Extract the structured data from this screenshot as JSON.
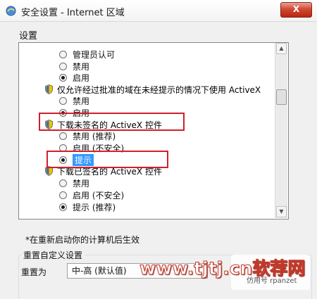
{
  "window": {
    "title": "安全设置 - Internet 区域",
    "close_label": "X"
  },
  "settings": {
    "group_label": "设置",
    "items": [
      {
        "type": "option",
        "label": "管理员认可",
        "checked": false
      },
      {
        "type": "option",
        "label": "禁用",
        "checked": false
      },
      {
        "type": "option",
        "label": "启用",
        "checked": true
      },
      {
        "type": "header",
        "label": "仅允许经过批准的域在未经提示的情况下使用 ActiveX"
      },
      {
        "type": "option",
        "label": "禁用",
        "checked": false
      },
      {
        "type": "option",
        "label": "启用",
        "checked": true
      },
      {
        "type": "header",
        "label": "下载未签名的 ActiveX 控件"
      },
      {
        "type": "option",
        "label": "禁用 (推荐)",
        "checked": false
      },
      {
        "type": "option",
        "label": "启用 (不安全)",
        "checked": false
      },
      {
        "type": "option",
        "label": "提示",
        "checked": true,
        "selected": true
      },
      {
        "type": "header",
        "label": "下载已签名的 ActiveX 控件"
      },
      {
        "type": "option",
        "label": "禁用",
        "checked": false
      },
      {
        "type": "option",
        "label": "启用 (不安全)",
        "checked": false
      },
      {
        "type": "option",
        "label": "提示 (推荐)",
        "checked": true
      }
    ]
  },
  "note": "*在重新启动你的计算机后生效",
  "reset": {
    "group_title": "重置自定义设置",
    "label": "重置为",
    "value": "中-高 (默认值)"
  },
  "watermark": {
    "text": "www.tjtj.cn软荐网",
    "sub": "仿用号 rpanzet"
  },
  "colors": {
    "highlight": "#3399ff",
    "annotation_box": "#d21f2b",
    "close_button": "#cf4a34"
  }
}
